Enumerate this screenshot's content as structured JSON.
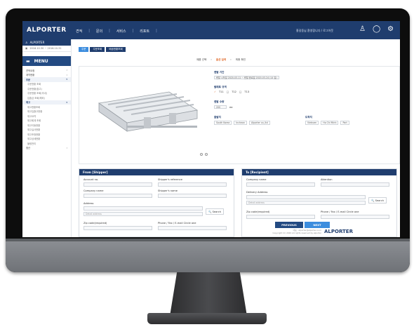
{
  "app": {
    "logo": "ALPORTER",
    "footer_logo": "ALPORTER"
  },
  "topnav": {
    "items": [
      "견적",
      "|",
      "문의",
      "|",
      "서비스",
      "|",
      "리포트",
      "|"
    ],
    "user_text": "홍길동님 환영합니다 / 로그아웃",
    "icons": [
      "user-icon",
      "globe-icon",
      "settings-icon"
    ]
  },
  "sidebar": {
    "user": "ALPORTER",
    "date": "2016.10.30 ~ 2016.10.31",
    "menu_title": "MENU",
    "items": [
      {
        "label": "견적요청",
        "type": "item"
      },
      {
        "label": "계약현황",
        "type": "item"
      },
      {
        "label": "주문",
        "type": "group"
      },
      {
        "label": "주문현황 조회",
        "type": "sub"
      },
      {
        "label": "주문현황(출고)",
        "type": "sub"
      },
      {
        "label": "주문현황 조회(국내)",
        "type": "sub"
      },
      {
        "label": "입출금 조회(해외)",
        "type": "sub"
      },
      {
        "label": "재고",
        "type": "group"
      },
      {
        "label": "재고현황조회",
        "type": "sub"
      },
      {
        "label": "재고입출고현황",
        "type": "sub"
      },
      {
        "label": "재고요약",
        "type": "sub"
      },
      {
        "label": "재고회계 조회",
        "type": "sub"
      },
      {
        "label": "재고이동현황",
        "type": "sub"
      },
      {
        "label": "재고실사현황",
        "type": "sub"
      },
      {
        "label": "재고조정현황",
        "type": "sub"
      },
      {
        "label": "재고상세현황",
        "type": "sub"
      },
      {
        "label": "불량관리",
        "type": "sub"
      },
      {
        "label": "정산",
        "type": "item"
      }
    ]
  },
  "tabs": [
    "주문",
    "주문조회",
    "배송현황조회"
  ],
  "steps": [
    "제품 선택",
    "›",
    "옵션 입력",
    "›",
    "최종 확인"
  ],
  "options": {
    "rental_label": "렌탈 기간",
    "rental_value": "렌탈 시작일 2020-03-11 ~ 렌탈 종료일 2020-03-24 (14 일)",
    "pallet_label": "팔레트 규격",
    "pallet_opts": [
      "T11",
      "T12",
      "T13"
    ],
    "qty_label": "렌탈 수량",
    "qty_value": "200",
    "qty_unit": "ea",
    "from_label": "출발지",
    "from_selects": [
      "South Korea",
      "Incheon",
      "Alporter co.,ltd"
    ],
    "to_label": "도착지",
    "to_selects": [
      "Vietnam",
      "Ho Chi Minh",
      "Port"
    ]
  },
  "from_box": {
    "title": "From [Shipper]",
    "account_no": "Account no.",
    "shipper_ref": "Shipper's reference",
    "company_name": "Company name",
    "shipper_name": "Shipper's name",
    "address": "Address",
    "address_placeholder": "Detail address",
    "search": "Search",
    "zip": "Zip code(required)",
    "phone": "Phone / Fax / E-mail Circle one"
  },
  "to_box": {
    "title": "To [Recipient]",
    "company_name": "Company name",
    "attention": "Attention",
    "address": "Delivery Address",
    "address_placeholder": "Detail address",
    "search": "Search",
    "zip": "Zip code(required)",
    "phone": "Phone / Fax / E-mail Circle one"
  },
  "buttons": {
    "previous": "PREVIOUS",
    "next": "NEXT"
  },
  "footer": {
    "line1": "대표 : alporter@alporter.co.kr",
    "line2": "Copyright (C) 2020 All rights reserved by alporter"
  }
}
